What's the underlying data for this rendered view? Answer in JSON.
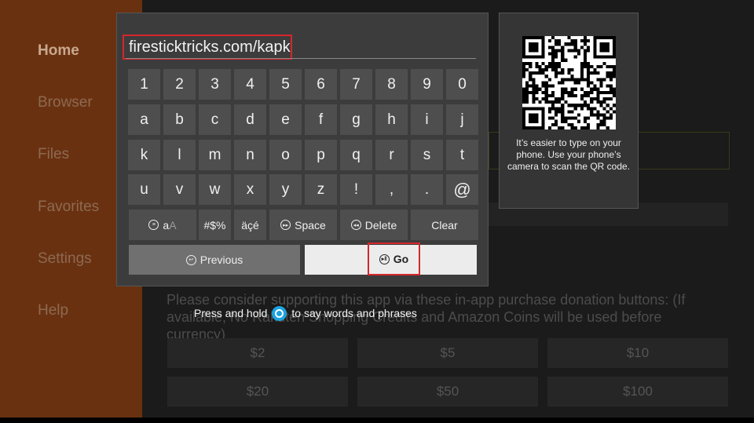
{
  "sidebar": {
    "items": [
      "Home",
      "Browser",
      "Files",
      "Favorites",
      "Settings",
      "Help"
    ]
  },
  "keyboard": {
    "url_value": "firesticktricks.com/kapk",
    "rows": [
      [
        "1",
        "2",
        "3",
        "4",
        "5",
        "6",
        "7",
        "8",
        "9",
        "0"
      ],
      [
        "a",
        "b",
        "c",
        "d",
        "e",
        "f",
        "g",
        "h",
        "i",
        "j"
      ],
      [
        "k",
        "l",
        "m",
        "n",
        "o",
        "p",
        "q",
        "r",
        "s",
        "t"
      ],
      [
        "u",
        "v",
        "w",
        "x",
        "y",
        "z",
        "!",
        ",",
        ".",
        "@"
      ]
    ],
    "func_keys": {
      "case": "a",
      "case_dim": "A",
      "symbols": "#$%",
      "accents": "äçé",
      "space": "Space",
      "delete": "Delete",
      "clear": "Clear"
    },
    "previous_label": "Previous",
    "go_label": "Go"
  },
  "qr_panel": {
    "text": "It’s easier to type on your phone. Use your phone’s camera to scan the QR code."
  },
  "voice_hint": {
    "before": "Press and hold",
    "after": "to say words and phrases"
  },
  "donation": {
    "text": "Please consider supporting this app via these in-app purchase donation buttons: (If available, No Rakuten Shopping Credits and Amazon Coins will be used before currency)",
    "buttons": [
      "$2",
      "$5",
      "$10",
      "$20",
      "$50",
      "$100"
    ]
  },
  "colors": {
    "highlight": "#d6262c",
    "sidebar": "#6a3110",
    "alexa": "#1ca3e0"
  }
}
